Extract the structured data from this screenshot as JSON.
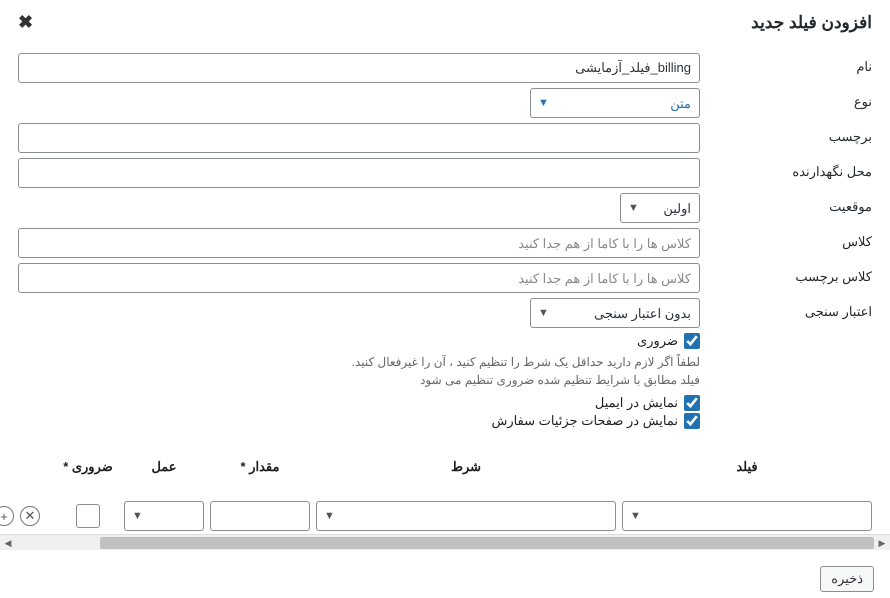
{
  "header": {
    "title": "افزودن فیلد جدید"
  },
  "form": {
    "name": {
      "label": "نام",
      "value": "billing_فیلد_آزمایشی"
    },
    "type": {
      "label": "نوع",
      "selected": "متن"
    },
    "field_label": {
      "label": "برچسب",
      "value": ""
    },
    "placeholder": {
      "label": "محل نگهدارنده",
      "value": ""
    },
    "position": {
      "label": "موقعیت",
      "selected": "اولین"
    },
    "class": {
      "label": "کلاس",
      "placeholder": "کلاس ها را با کاما از هم جدا کنید",
      "value": ""
    },
    "label_class": {
      "label": "کلاس برچسب",
      "placeholder": "کلاس ها را با کاما از هم جدا کنید",
      "value": ""
    },
    "validation": {
      "label": "اعتبار سنجی",
      "selected": "بدون اعتبار سنجی"
    },
    "required": {
      "label": "ضروری",
      "help": "لطفاً اگر لازم دارید حداقل یک شرط را تنظیم کنید ، آن را غیرفعال کنید. فیلد مطابق با شرایط تنظیم شده ضروری تنظیم می شود"
    },
    "show_email": {
      "label": "نمایش در ایمیل"
    },
    "show_order": {
      "label": "نمایش در صفحات جزئیات سفارش"
    }
  },
  "conditions": {
    "headers": {
      "field": "فیلد",
      "cond": "شرط",
      "value": "مقدار *",
      "op": "عمل",
      "req": "ضروری *"
    }
  },
  "footer": {
    "save": "ذخیره"
  }
}
